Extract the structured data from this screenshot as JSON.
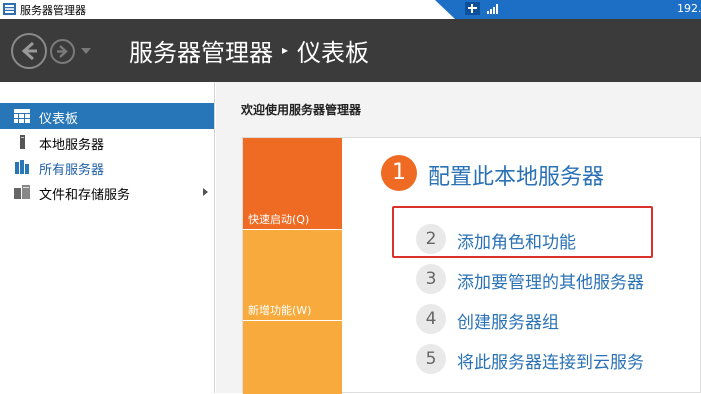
{
  "window": {
    "title": "服务器管理器",
    "remote_address": "192."
  },
  "header": {
    "breadcrumb_root": "服务器管理器",
    "breadcrumb_separator": "▸",
    "breadcrumb_current": "仪表板"
  },
  "sidebar": {
    "items": [
      {
        "label": "仪表板",
        "icon": "dashboard-icon",
        "selected": true
      },
      {
        "label": "本地服务器",
        "icon": "local-server-icon"
      },
      {
        "label": "所有服务器",
        "icon": "all-servers-icon"
      },
      {
        "label": "文件和存储服务",
        "icon": "file-storage-icon",
        "has_submenu": true
      }
    ]
  },
  "main": {
    "welcome_title": "欢迎使用服务器管理器",
    "tiles": [
      {
        "label": "快速启动(Q)",
        "color": "#ef6a22"
      },
      {
        "label": "新增功能(W)",
        "color": "#f8ab3c"
      },
      {
        "label": "",
        "color": "#f8ab3c"
      }
    ],
    "steps": [
      {
        "number": "1",
        "label": "配置此本地服务器"
      },
      {
        "number": "2",
        "label": "添加角色和功能",
        "highlighted": true
      },
      {
        "number": "3",
        "label": "添加要管理的其他服务器"
      },
      {
        "number": "4",
        "label": "创建服务器组"
      },
      {
        "number": "5",
        "label": "将此服务器连接到云服务"
      }
    ]
  },
  "colors": {
    "header_bg": "#3b3b3b",
    "accent_blue": "#2676b8",
    "link_blue": "#2a72b5",
    "quick_start_orange": "#ef6a22",
    "tile_orange": "#f8ab3c",
    "highlight_red": "#d9312b"
  }
}
